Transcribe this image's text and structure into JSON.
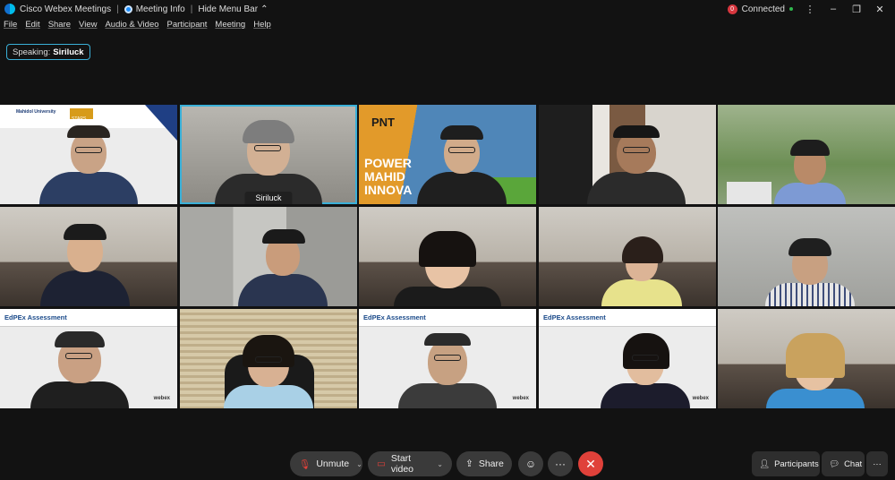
{
  "titlebar": {
    "app_name": "Cisco Webex Meetings",
    "meeting_info": "Meeting Info",
    "hide_menu": "Hide Menu Bar",
    "status_badge": "0",
    "status": "Connected"
  },
  "menu": [
    "File",
    "Edit",
    "Share",
    "View",
    "Audio & Video",
    "Participant",
    "Meeting",
    "Help"
  ],
  "speaking": {
    "label": "Speaking:",
    "name": "Siriluck"
  },
  "tiles": [
    {
      "name_tag": ""
    },
    {
      "name_tag": "Siriluck"
    }
  ],
  "slides": {
    "edpex_title": "EdPEx Assessment",
    "webex_mark": "webex",
    "mahidol_name": "Mahidol University",
    "stars_label": "STARS",
    "pnt_label": "PNT",
    "power_line1": "POWER",
    "power_line2": "MAHID",
    "power_line3": "INNOVA"
  },
  "controls": {
    "unmute": "Unmute",
    "start_video": "Start video",
    "share": "Share",
    "participants": "Participants",
    "chat": "Chat"
  },
  "colors": {
    "accent": "#3ab0d8",
    "end_call": "#e0413a",
    "background": "#121212"
  }
}
